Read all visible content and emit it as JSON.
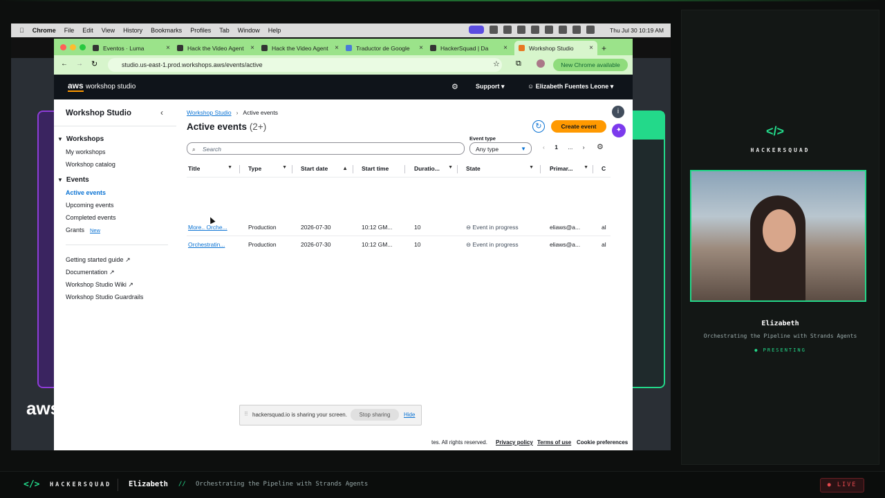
{
  "menubar": {
    "app": "Chrome",
    "items": [
      "File",
      "Edit",
      "View",
      "History",
      "Bookmarks",
      "Profiles",
      "Tab",
      "Window",
      "Help"
    ],
    "clock": "Thu Jul 30  10:19 AM"
  },
  "tabs": [
    {
      "label": "Eventos · Luma"
    },
    {
      "label": "Hack the Video Agent"
    },
    {
      "label": "Hack the Video Agent"
    },
    {
      "label": "Traductor de Google"
    },
    {
      "label": "HackerSquad | Da"
    },
    {
      "label": "Workshop Studio",
      "active": true
    }
  ],
  "address": {
    "url": "studio.us-east-1.prod.workshops.aws/events/active",
    "new_chrome": "New Chrome available"
  },
  "aws_header": {
    "logo": "aws",
    "product": "workshop studio",
    "support": "Support",
    "user": "Elizabeth Fuentes Leone"
  },
  "sidebar": {
    "title": "Workshop Studio",
    "workshops_header": "Workshops",
    "workshops_items": [
      "My workshops",
      "Workshop catalog"
    ],
    "events_header": "Events",
    "events_items": [
      "Active events",
      "Upcoming events",
      "Completed events",
      "Grants"
    ],
    "new_badge": "New",
    "links": [
      "Getting started guide",
      "Documentation",
      "Workshop Studio Wiki",
      "Workshop Studio Guardrails"
    ]
  },
  "main": {
    "breadcrumb": [
      "Workshop Studio",
      "Active events"
    ],
    "title": "Active events",
    "count": "(2+)",
    "create_button": "Create event",
    "search_placeholder": "Search",
    "event_type_label": "Event type",
    "event_type_value": "Any type",
    "page": "1",
    "ellipsis": "...",
    "columns": [
      "Title",
      "Type",
      "Start date",
      "Start time",
      "Duratio...",
      "State",
      "Primar...",
      "C"
    ],
    "rows": [
      {
        "title": "More.. Orche...",
        "type": "Production",
        "start_date": "2026-07-30",
        "start_time": "10:12 GM...",
        "duration": "10",
        "state": "Event in progress",
        "primary": "eliaws@a...",
        "c": "al"
      },
      {
        "title": "Orchestratin...",
        "type": "Production",
        "start_date": "2026-07-30",
        "start_time": "10:12 GM...",
        "duration": "10",
        "state": "Event in progress",
        "primary": "eliaws@a...",
        "c": "al"
      }
    ]
  },
  "share_banner": {
    "text": "hackersquad.io is sharing your screen.",
    "stop": "Stop sharing",
    "hide": "Hide"
  },
  "footer": {
    "copyright_tail": "tes. All rights reserved.",
    "privacy": "Privacy policy",
    "terms": "Terms of use",
    "cookies": "Cookie preferences"
  },
  "slide": {
    "logo": "aws"
  },
  "presenter": {
    "brand": "HACKERSQUAD",
    "name": "Elizabeth",
    "talk": "Orchestrating the Pipeline with Strands Agents",
    "status": "PRESENTING"
  },
  "bottom_bar": {
    "brand": "HACKERSQUAD",
    "name": "Elizabeth",
    "slashes": "//",
    "talk": "Orchestrating the Pipeline with Strands Agents",
    "live": "LIVE"
  },
  "colors": {
    "accent_green": "#23d98a",
    "aws_orange": "#ff9900",
    "link_blue": "#0972d3",
    "purple": "#8e3cd8"
  }
}
